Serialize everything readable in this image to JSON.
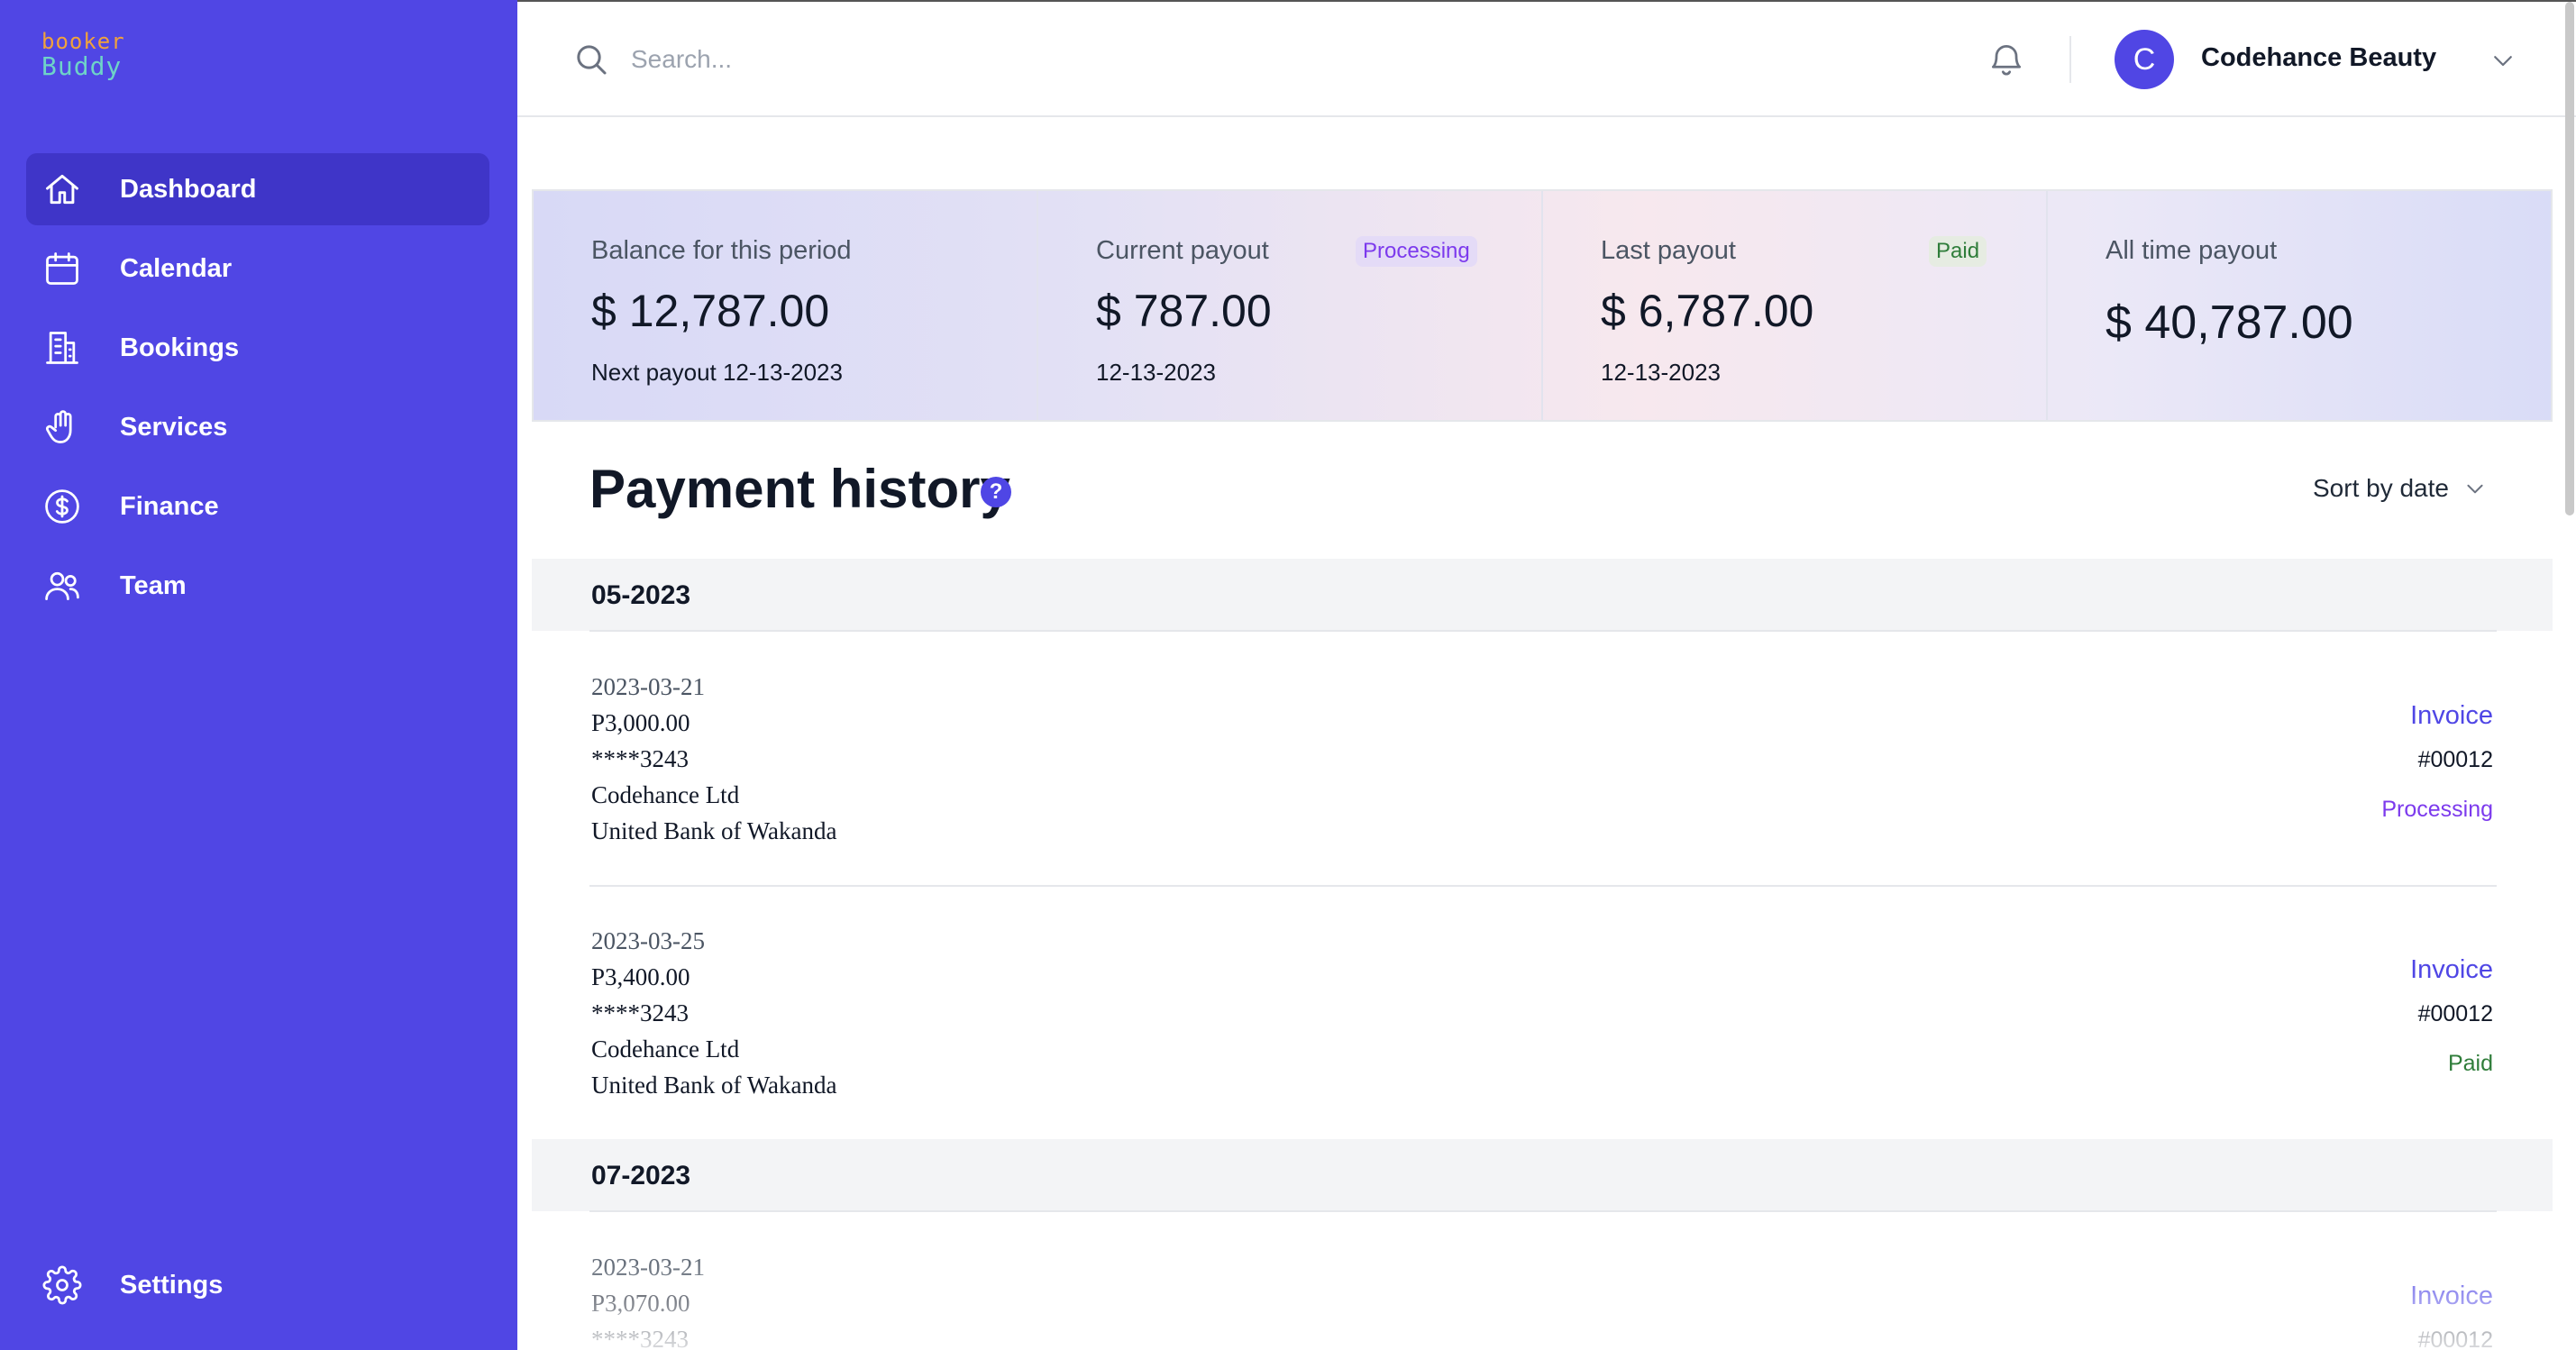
{
  "app": {
    "logo_line1": "booker",
    "logo_line2": "Buddy",
    "accent_color": "#5046e4"
  },
  "sidebar": {
    "items": [
      {
        "label": "Dashboard",
        "icon": "home-icon",
        "active": true
      },
      {
        "label": "Calendar",
        "icon": "calendar-icon"
      },
      {
        "label": "Bookings",
        "icon": "building-icon"
      },
      {
        "label": "Services",
        "icon": "hand-icon"
      },
      {
        "label": "Finance",
        "icon": "dollar-circle-icon"
      },
      {
        "label": "Team",
        "icon": "users-icon"
      }
    ],
    "settings_label": "Settings"
  },
  "header": {
    "search_placeholder": "Search...",
    "avatar_initial": "C",
    "user_name": "Codehance Beauty"
  },
  "stats": [
    {
      "title": "Balance for this period",
      "amount": "$ 12,787.00",
      "sub": "Next payout 12-13-2023"
    },
    {
      "title": "Current payout",
      "badge": "Processing",
      "amount": "$ 787.00",
      "sub": "12-13-2023"
    },
    {
      "title": "Last payout",
      "badge": "Paid",
      "amount": "$ 6,787.00",
      "sub": "12-13-2023"
    },
    {
      "title": "All time payout",
      "amount": "$ 40,787.00"
    }
  ],
  "history": {
    "title": "Payment history",
    "help": "?",
    "sort_label": "Sort by date",
    "groups": [
      {
        "label": "05-2023",
        "payments": [
          {
            "date": "2023-03-21",
            "amount": "P3,000.00",
            "account": "****3243",
            "company": "Codehance Ltd",
            "bank": "United Bank of Wakanda",
            "invoice_label": "Invoice",
            "invoice_number": "#00012",
            "status": "Processing"
          },
          {
            "date": "2023-03-25",
            "amount": "P3,400.00",
            "account": "****3243",
            "company": "Codehance Ltd",
            "bank": "United Bank of Wakanda",
            "invoice_label": "Invoice",
            "invoice_number": "#00012",
            "status": "Paid"
          }
        ]
      },
      {
        "label": "07-2023",
        "payments": [
          {
            "date": "2023-03-21",
            "amount": "P3,070.00",
            "account": "****3243",
            "invoice_label": "Invoice",
            "invoice_number": "#00012"
          }
        ]
      }
    ]
  },
  "colors": {
    "processing": "#7c3aed",
    "paid": "#2f7d3a",
    "link": "#4f46e5"
  }
}
